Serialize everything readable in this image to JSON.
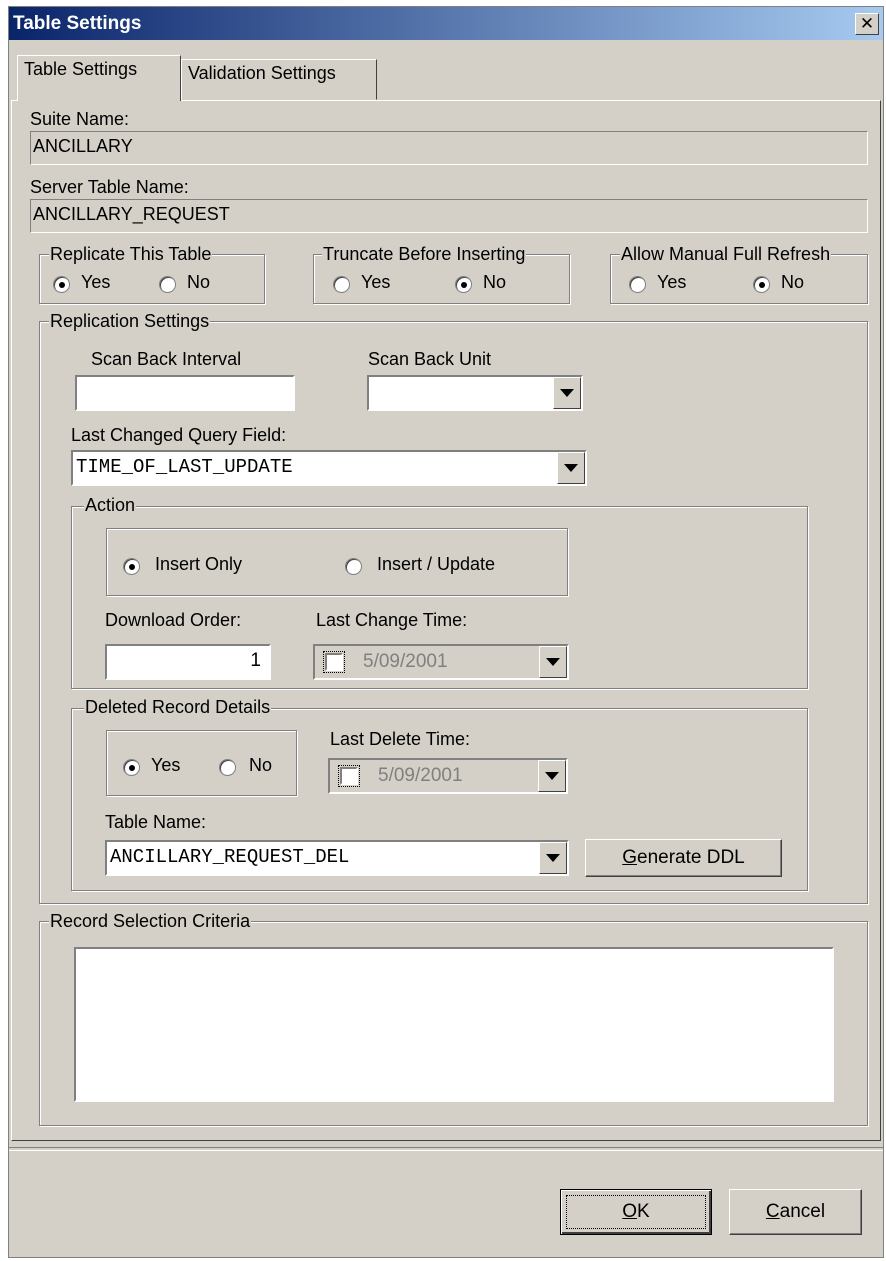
{
  "window": {
    "title": "Table Settings",
    "close_glyph": "✕"
  },
  "tabs": [
    {
      "label": "Table Settings",
      "active": true
    },
    {
      "label": "Validation Settings",
      "active": false
    }
  ],
  "suite": {
    "label": "Suite Name:",
    "value": "ANCILLARY"
  },
  "server_table": {
    "label": "Server Table Name:",
    "value": "ANCILLARY_REQUEST"
  },
  "replicate": {
    "legend": "Replicate This Table",
    "yes": "Yes",
    "no": "No",
    "selected": "Yes"
  },
  "truncate": {
    "legend": "Truncate Before Inserting",
    "yes": "Yes",
    "no": "No",
    "selected": "No"
  },
  "manual_refresh": {
    "legend": "Allow Manual Full Refresh",
    "yes": "Yes",
    "no": "No",
    "selected": "No"
  },
  "replication": {
    "legend": "Replication Settings",
    "scan_back_interval_label": "Scan Back Interval",
    "scan_back_interval_value": "",
    "scan_back_unit_label": "Scan Back Unit",
    "scan_back_unit_value": "",
    "last_changed_label": "Last Changed Query Field:",
    "last_changed_value": "TIME_OF_LAST_UPDATE"
  },
  "action": {
    "legend": "Action",
    "insert_only": "Insert Only",
    "insert_update": "Insert / Update",
    "selected": "Insert Only",
    "download_order_label": "Download Order:",
    "download_order_value": "1",
    "last_change_time_label": "Last Change Time:",
    "last_change_time_value": "5/09/2001"
  },
  "deleted": {
    "legend": "Deleted Record Details",
    "yes": "Yes",
    "no": "No",
    "selected": "Yes",
    "last_delete_time_label": "Last Delete Time:",
    "last_delete_time_value": "5/09/2001",
    "table_name_label": "Table Name:",
    "table_name_value": "ANCILLARY_REQUEST_DEL",
    "generate_ddl_accel": "G",
    "generate_ddl_rest": "enerate DDL"
  },
  "criteria": {
    "legend": "Record Selection Criteria",
    "value": ""
  },
  "footer": {
    "ok_accel": "O",
    "ok_rest": "K",
    "cancel_accel": "C",
    "cancel_rest": "ancel"
  }
}
